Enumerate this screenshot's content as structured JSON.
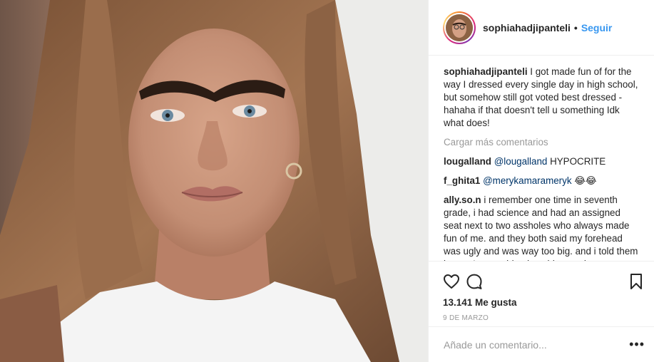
{
  "post": {
    "image_alt": "Portrait photo of a young woman with long hair and a unibrow"
  },
  "header": {
    "username": "sophiahadjipanteli",
    "separator": "•",
    "follow_label": "Seguir"
  },
  "caption": {
    "username": "sophiahadjipanteli",
    "text": "I got made fun of for the way I dressed every single day in high school, but somehow still got voted best dressed - hahaha if that doesn't tell u something Idk what does!"
  },
  "load_more_label": "Cargar más comentarios",
  "comments": [
    {
      "username": "lougalland",
      "mention": "@lougalland",
      "text": " HYPOCRITE"
    },
    {
      "username": "f_ghita1",
      "mention": "@merykamarameryk",
      "text": " 😂😂"
    },
    {
      "username": "ally.so.n",
      "mention": "",
      "text": "i remember one time in seventh grade, i had science and had an assigned seat next to two assholes who always made fun of me. and they both said my forehead was ugly and was way too big. and i told them it wasn't something i could control"
    }
  ],
  "stats": {
    "likes": "13.141 Me gusta",
    "date": "9 DE MARZO"
  },
  "add_comment": {
    "placeholder": "Añade un comentario...",
    "more_label": "•••"
  },
  "icons": [
    "heart-icon",
    "comment-icon",
    "bookmark-icon"
  ]
}
